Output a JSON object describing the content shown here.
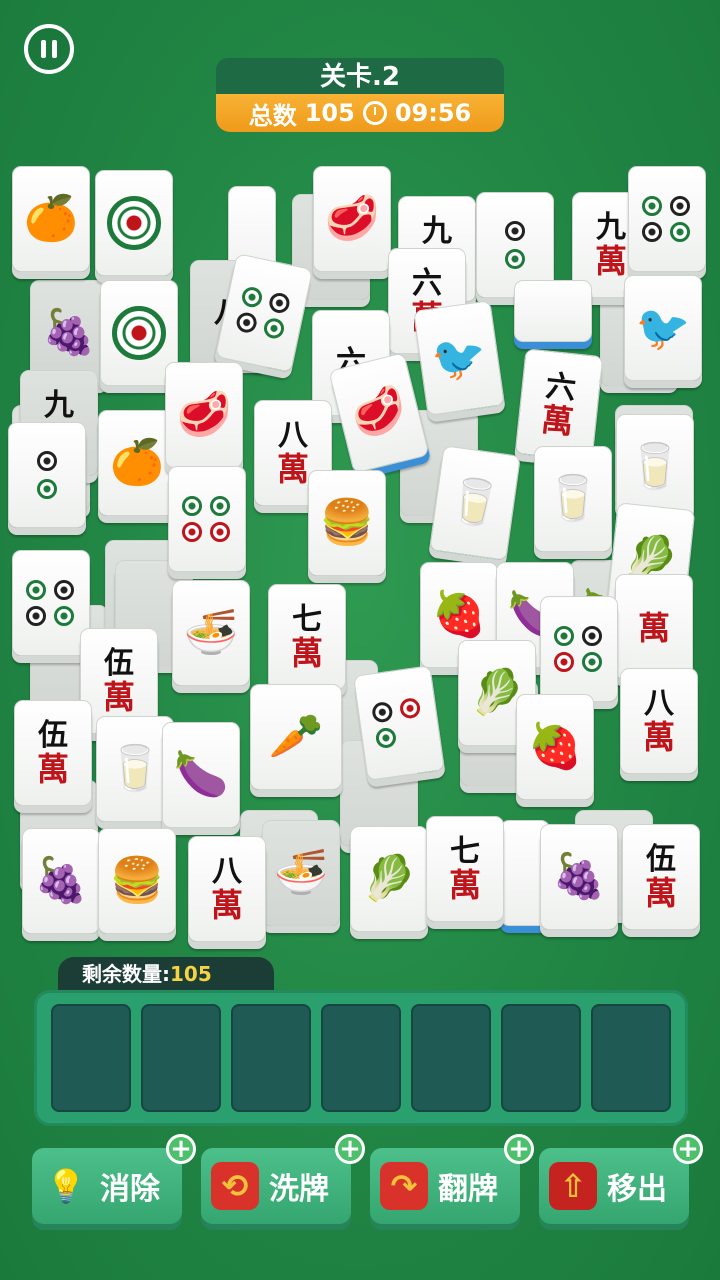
{
  "hud": {
    "level": "关卡.2",
    "total_label": "总数",
    "total_value": "105",
    "timer": "09:56"
  },
  "remaining": {
    "label": "剩余数量:",
    "value": "105"
  },
  "tray_slots": 7,
  "tools": [
    {
      "label": "消除",
      "icon": "lightbulb-icon"
    },
    {
      "label": "洗牌",
      "icon": "shuffle-cards-icon"
    },
    {
      "label": "翻牌",
      "icon": "flip-card-icon"
    },
    {
      "label": "移出",
      "icon": "move-out-icon"
    }
  ],
  "tiles_visible": {
    "fruit": [
      "orange",
      "strawberry",
      "grapes",
      "eggplant",
      "carrot"
    ],
    "food": [
      "meat",
      "burger",
      "noodles",
      "milk",
      "leek"
    ],
    "characters": [
      "九",
      "六",
      "八",
      "七",
      "伍"
    ],
    "wan": "萬"
  }
}
